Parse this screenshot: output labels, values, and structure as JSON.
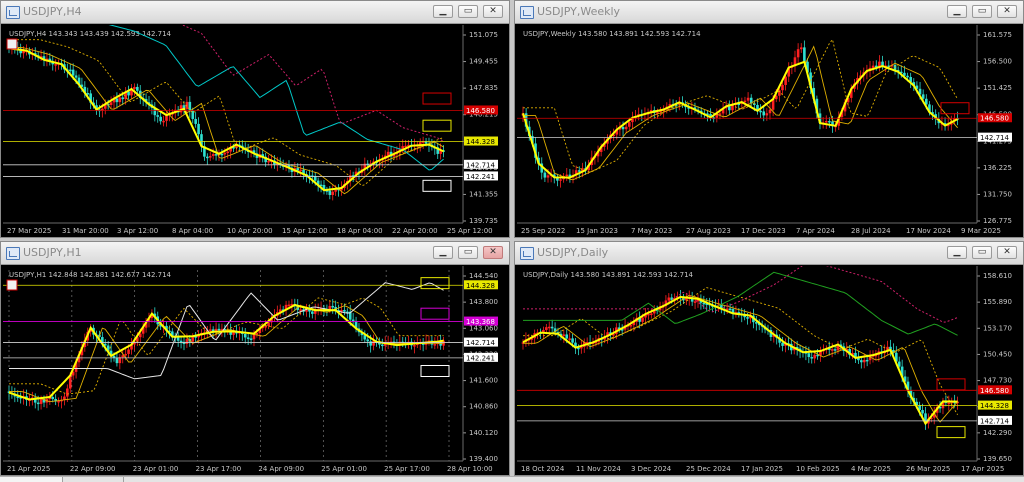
{
  "windows": [
    {
      "id": "h4",
      "title": "USDJPY,H4",
      "info": "USDJPY,H4  143.343 143.439 142.593 142.714",
      "close_active": false,
      "price_labels": [
        "151.075",
        "149.455",
        "147.835",
        "146.215",
        "144.595",
        "142.975",
        "141.355",
        "139.735"
      ],
      "time_labels": [
        "27 Mar 2025",
        "31 Mar 20:00",
        "3 Apr 12:00",
        "8 Apr 04:00",
        "10 Apr 20:00",
        "15 Apr 12:00",
        "18 Apr 04:00",
        "22 Apr 20:00",
        "25 Apr 12:00"
      ],
      "tags": [
        {
          "text": "146.580",
          "color": "#d50000",
          "text_color": "#ffffff"
        },
        {
          "text": "144.328",
          "color": "#e8e800",
          "text_color": "#000000"
        },
        {
          "text": "142.714",
          "color": "#ffffff",
          "text_color": "#000000"
        },
        {
          "text": "142.241",
          "color": "#ffffff",
          "text_color": "#000000"
        }
      ]
    },
    {
      "id": "weekly",
      "title": "USDJPY,Weekly",
      "info": "USDJPY,Weekly  143.580 143.891 142.593 142.714",
      "close_active": false,
      "price_labels": [
        "161.575",
        "156.500",
        "151.425",
        "146.580",
        "141.275",
        "136.225",
        "131.750",
        "126.775"
      ],
      "time_labels": [
        "25 Sep 2022",
        "15 Jan 2023",
        "7 May 2023",
        "27 Aug 2023",
        "17 Dec 2023",
        "7 Apr 2024",
        "28 Jul 2024",
        "17 Nov 2024",
        "9 Mar 2025"
      ],
      "tags": [
        {
          "text": "146.580",
          "color": "#d50000",
          "text_color": "#ffffff"
        },
        {
          "text": "142.714",
          "color": "#ffffff",
          "text_color": "#000000"
        }
      ]
    },
    {
      "id": "h1",
      "title": "USDJPY,H1",
      "info": "USDJPY,H1  142.848 142.881 142.677 142.714",
      "close_active": true,
      "price_labels": [
        "144.540",
        "143.800",
        "143.060",
        "142.320",
        "141.600",
        "140.860",
        "140.120",
        "139.400"
      ],
      "time_labels": [
        "21 Apr 2025",
        "22 Apr 09:00",
        "23 Apr 01:00",
        "23 Apr 17:00",
        "24 Apr 09:00",
        "25 Apr 01:00",
        "25 Apr 17:00",
        "28 Apr 10:00"
      ],
      "tags": [
        {
          "text": "144.328",
          "color": "#e8e800",
          "text_color": "#000000"
        },
        {
          "text": "143.368",
          "color": "#d400d4",
          "text_color": "#ffffff"
        },
        {
          "text": "142.714",
          "color": "#ffffff",
          "text_color": "#000000"
        },
        {
          "text": "142.241",
          "color": "#ffffff",
          "text_color": "#000000"
        }
      ]
    },
    {
      "id": "daily",
      "title": "USDJPY,Daily",
      "info": "USDJPY,Daily  143.580 143.891 142.593 142.714",
      "close_active": false,
      "price_labels": [
        "158.610",
        "155.890",
        "153.170",
        "150.450",
        "147.730",
        "145.010",
        "142.290",
        "139.650"
      ],
      "time_labels": [
        "18 Oct 2024",
        "11 Nov 2024",
        "3 Dec 2024",
        "25 Dec 2024",
        "17 Jan 2025",
        "10 Feb 2025",
        "4 Mar 2025",
        "26 Mar 2025",
        "17 Apr 2025"
      ],
      "tags": [
        {
          "text": "146.580",
          "color": "#d50000",
          "text_color": "#ffffff"
        },
        {
          "text": "144.328",
          "color": "#e8e800",
          "text_color": "#000000"
        },
        {
          "text": "142.714",
          "color": "#ffffff",
          "text_color": "#000000"
        }
      ]
    }
  ],
  "colors": {
    "bull": "#ff2020",
    "bear": "#2ee0d0",
    "zigzag": "#ffff00",
    "ma_fast": "#e0b000",
    "ma_slow": "#00c8c8",
    "ma_long": "#d0206a",
    "grid": "#3a3a3a"
  },
  "icons": {
    "window": "chart-window-icon",
    "minimize": "minimize-icon",
    "maximize": "maximize-icon",
    "close": "close-icon"
  }
}
